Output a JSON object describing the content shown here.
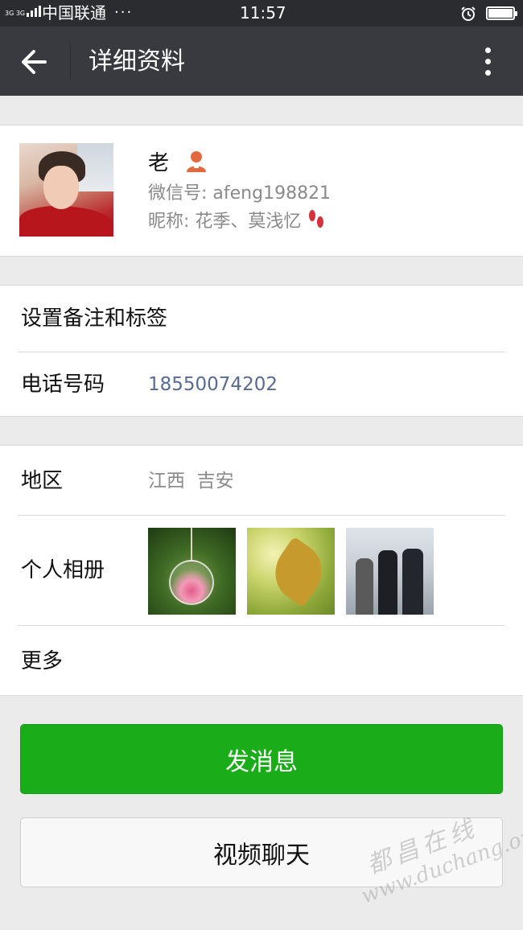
{
  "status_bar": {
    "network": "3G 3G",
    "carrier": "中国联通",
    "dots": "···",
    "time": "11:57"
  },
  "header": {
    "title": "详细资料"
  },
  "profile": {
    "name": "老",
    "wechat_id": "微信号: afeng198821",
    "nickname": "昵称: 花季、莫浅忆"
  },
  "rows": {
    "remark_label": "设置备注和标签",
    "phone_label": "电话号码",
    "phone_value": "18550074202",
    "region_label": "地区",
    "region_value": "江西  吉安",
    "album_label": "个人相册",
    "more_label": "更多"
  },
  "buttons": {
    "send_message": "发消息",
    "video_chat": "视频聊天"
  },
  "watermark": {
    "chinese": "都昌在线",
    "url": "www.duchang.org"
  },
  "colors": {
    "header_bg": "#393a3f",
    "status_bg": "#2a2c2f",
    "accent_green": "#1aad19",
    "phone_link": "#576b95",
    "secondary_text": "#8a8a8a",
    "person_icon": "#e2693e"
  }
}
